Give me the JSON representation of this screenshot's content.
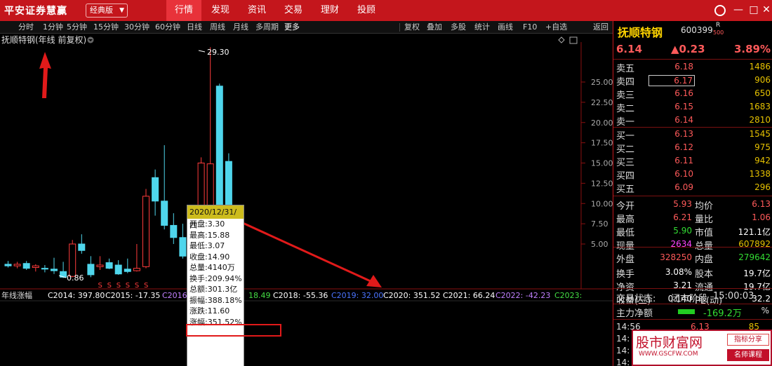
{
  "app": {
    "logo": "平安证券慧赢",
    "edition": "经典版"
  },
  "nav_tabs": [
    "行情",
    "发现",
    "资讯",
    "交易",
    "理财",
    "投顾"
  ],
  "active_nav": "行情",
  "periods": [
    "分时",
    "1分钟",
    "5分钟",
    "15分钟",
    "30分钟",
    "60分钟",
    "日线",
    "周线",
    "月线",
    "多周期",
    "更多"
  ],
  "tools": [
    "复权",
    "叠加",
    "多股",
    "统计",
    "画线",
    "F10",
    "+自选",
    "返回"
  ],
  "chart": {
    "title": "抚顺特钢(年线 前复权)",
    "max_label": "29.30",
    "min_label": "0.86",
    "y_ticks": [
      "25.00",
      "22.50",
      "20.00",
      "17.50",
      "15.00",
      "12.50",
      "10.00",
      "7.50",
      "5.00"
    ],
    "indicator_name": "年线涨幅",
    "indicator_items": [
      {
        "label": "C2014: 397.80",
        "color": "#ffffff"
      },
      {
        "label": "C2015: -17.35",
        "color": "#ffffff"
      },
      {
        "label": "C2016:",
        "color": "#c080ff"
      },
      {
        "label": "18.49",
        "color": "#44dd44"
      },
      {
        "label": "C2018: -55.36",
        "color": "#ffffff"
      },
      {
        "label": "C2019: 32.00",
        "color": "#4a74ff"
      },
      {
        "label": "C2020: 351.52",
        "color": "#ffffff"
      },
      {
        "label": "C2021: 66.24",
        "color": "#ffffff"
      },
      {
        "label": "C2022: -42.23",
        "color": "#c080ff"
      },
      {
        "label": "C2023:",
        "color": "#44dd44"
      }
    ],
    "s_marker": "S"
  },
  "chart_data": {
    "type": "candlestick",
    "ylim": [
      0,
      30
    ],
    "candles": [
      {
        "o": 2.5,
        "h": 2.9,
        "l": 2.1,
        "c": 2.3
      },
      {
        "o": 2.3,
        "h": 2.8,
        "l": 2.0,
        "c": 2.5
      },
      {
        "o": 2.6,
        "h": 2.9,
        "l": 1.8,
        "c": 2.0
      },
      {
        "o": 2.1,
        "h": 2.5,
        "l": 1.6,
        "c": 2.3
      },
      {
        "o": 2.0,
        "h": 2.4,
        "l": 1.5,
        "c": 1.9
      },
      {
        "o": 1.9,
        "h": 3.3,
        "l": 1.3,
        "c": 1.7
      },
      {
        "o": 1.6,
        "h": 2.8,
        "l": 0.8,
        "c": 0.9
      },
      {
        "o": 1.0,
        "h": 5.5,
        "l": 0.9,
        "c": 5.0
      },
      {
        "o": 5.0,
        "h": 6.2,
        "l": 3.8,
        "c": 4.2
      },
      {
        "o": 2.5,
        "h": 3.5,
        "l": 0.9,
        "c": 1.2
      },
      {
        "o": 2.2,
        "h": 3.5,
        "l": 1.8,
        "c": 2.4
      },
      {
        "o": 2.7,
        "h": 3.2,
        "l": 1.9,
        "c": 2.0
      },
      {
        "o": 2.4,
        "h": 3.0,
        "l": 1.2,
        "c": 1.3
      },
      {
        "o": 1.9,
        "h": 3.2,
        "l": 1.4,
        "c": 1.6
      },
      {
        "o": 1.7,
        "h": 5.0,
        "l": 1.6,
        "c": 2.0
      },
      {
        "o": 2.2,
        "h": 11.8,
        "l": 2.0,
        "c": 10.9
      },
      {
        "o": 13.2,
        "h": 14.2,
        "l": 8.5,
        "c": 10.3
      },
      {
        "o": 10.3,
        "h": 17.2,
        "l": 6.8,
        "c": 7.3
      },
      {
        "o": 7.3,
        "h": 8.8,
        "l": 5.0,
        "c": 5.8
      },
      {
        "o": 5.8,
        "h": 7.5,
        "l": 3.2,
        "c": 3.5
      },
      {
        "o": 2.0,
        "h": 6.2,
        "l": 1.6,
        "c": 1.9
      },
      {
        "o": 5.0,
        "h": 15.7,
        "l": 4.8,
        "c": 15.0
      },
      {
        "o": 3.3,
        "h": 29.3,
        "l": 3.07,
        "c": 14.9
      },
      {
        "o": 24.5,
        "h": 24.8,
        "l": 7.5,
        "c": 8.2
      },
      {
        "o": 15.2,
        "h": 16.2,
        "l": 9.0,
        "c": 9.5
      }
    ]
  },
  "tooltip": {
    "date": "2020/12/31/四",
    "lines": [
      "开盘:3.30",
      "最高:15.88",
      "最低:3.07",
      "收盘:14.90",
      "总量:4140万",
      "换手:209.94%",
      "总额:301.3亿",
      "振幅:388.18%",
      "涨跌:11.60",
      "涨幅:351.52%"
    ]
  },
  "stock": {
    "name": "抚顺特钢",
    "code": "600399",
    "badge_r": "R",
    "badge_500": "500",
    "price": "6.14",
    "change": "▲0.23",
    "pct": "3.89%"
  },
  "sell_orders": [
    {
      "label": "卖五",
      "price": "6.18",
      "vol": "1486"
    },
    {
      "label": "卖四",
      "price": "6.17",
      "vol": "906"
    },
    {
      "label": "卖三",
      "price": "6.16",
      "vol": "650"
    },
    {
      "label": "卖二",
      "price": "6.15",
      "vol": "1683"
    },
    {
      "label": "卖一",
      "price": "6.14",
      "vol": "2810"
    }
  ],
  "buy_orders": [
    {
      "label": "买一",
      "price": "6.13",
      "vol": "1545"
    },
    {
      "label": "买二",
      "price": "6.12",
      "vol": "975"
    },
    {
      "label": "买三",
      "price": "6.11",
      "vol": "942"
    },
    {
      "label": "买四",
      "price": "6.10",
      "vol": "1338"
    },
    {
      "label": "买五",
      "price": "6.09",
      "vol": "296"
    }
  ],
  "stats": [
    {
      "l1": "今开",
      "v1": "5.93",
      "c1": "#ff5a5a",
      "l2": "均价",
      "v2": "6.13",
      "c2": "#ff5a5a"
    },
    {
      "l1": "最高",
      "v1": "6.21",
      "c1": "#ff5a5a",
      "l2": "量比",
      "v2": "1.06",
      "c2": "#ff5a5a"
    },
    {
      "l1": "最低",
      "v1": "5.90",
      "c1": "#33dd33",
      "l2": "市值",
      "v2": "121.1亿",
      "c2": "#ffffff"
    },
    {
      "l1": "现量",
      "v1": "2634",
      "c1": "#ff44ff",
      "l2": "总量",
      "v2": "607892",
      "c2": "#e5c100"
    },
    {
      "l1": "外盘",
      "v1": "328250",
      "c1": "#ff5a5a",
      "l2": "内盘",
      "v2": "279642",
      "c2": "#33dd33"
    },
    {
      "l1": "换手",
      "v1": "3.08%",
      "c1": "#ffffff",
      "l2": "股本",
      "v2": "19.7亿",
      "c2": "#ffffff"
    },
    {
      "l1": "净资",
      "v1": "3.21",
      "c1": "#ffffff",
      "l2": "流通",
      "v2": "19.7亿",
      "c2": "#ffffff"
    },
    {
      "l1": "收益(三)",
      "v1": "0.140",
      "c1": "#ffffff",
      "l2": "PE(动)",
      "v2": "32.2",
      "c2": "#ffffff"
    }
  ],
  "trade_status": {
    "label": "交易状态:",
    "value": "闭市阶段",
    "time": "15:00:03"
  },
  "main_flow": {
    "label": "主力净额",
    "value": "-169.2万",
    "unit": "%"
  },
  "ticks": [
    {
      "time": "14:56",
      "price": "6.13",
      "vol": "85"
    },
    {
      "time": "14:",
      "price": "",
      "vol": ""
    },
    {
      "time": "14:",
      "price": "",
      "vol": ""
    },
    {
      "time": "14:",
      "price": "",
      "vol": ""
    }
  ],
  "watermark": {
    "main": "股市财富网",
    "site": "WWW.GSCFW.COM",
    "tag1": "指标分享",
    "tag2": "名师课程"
  }
}
